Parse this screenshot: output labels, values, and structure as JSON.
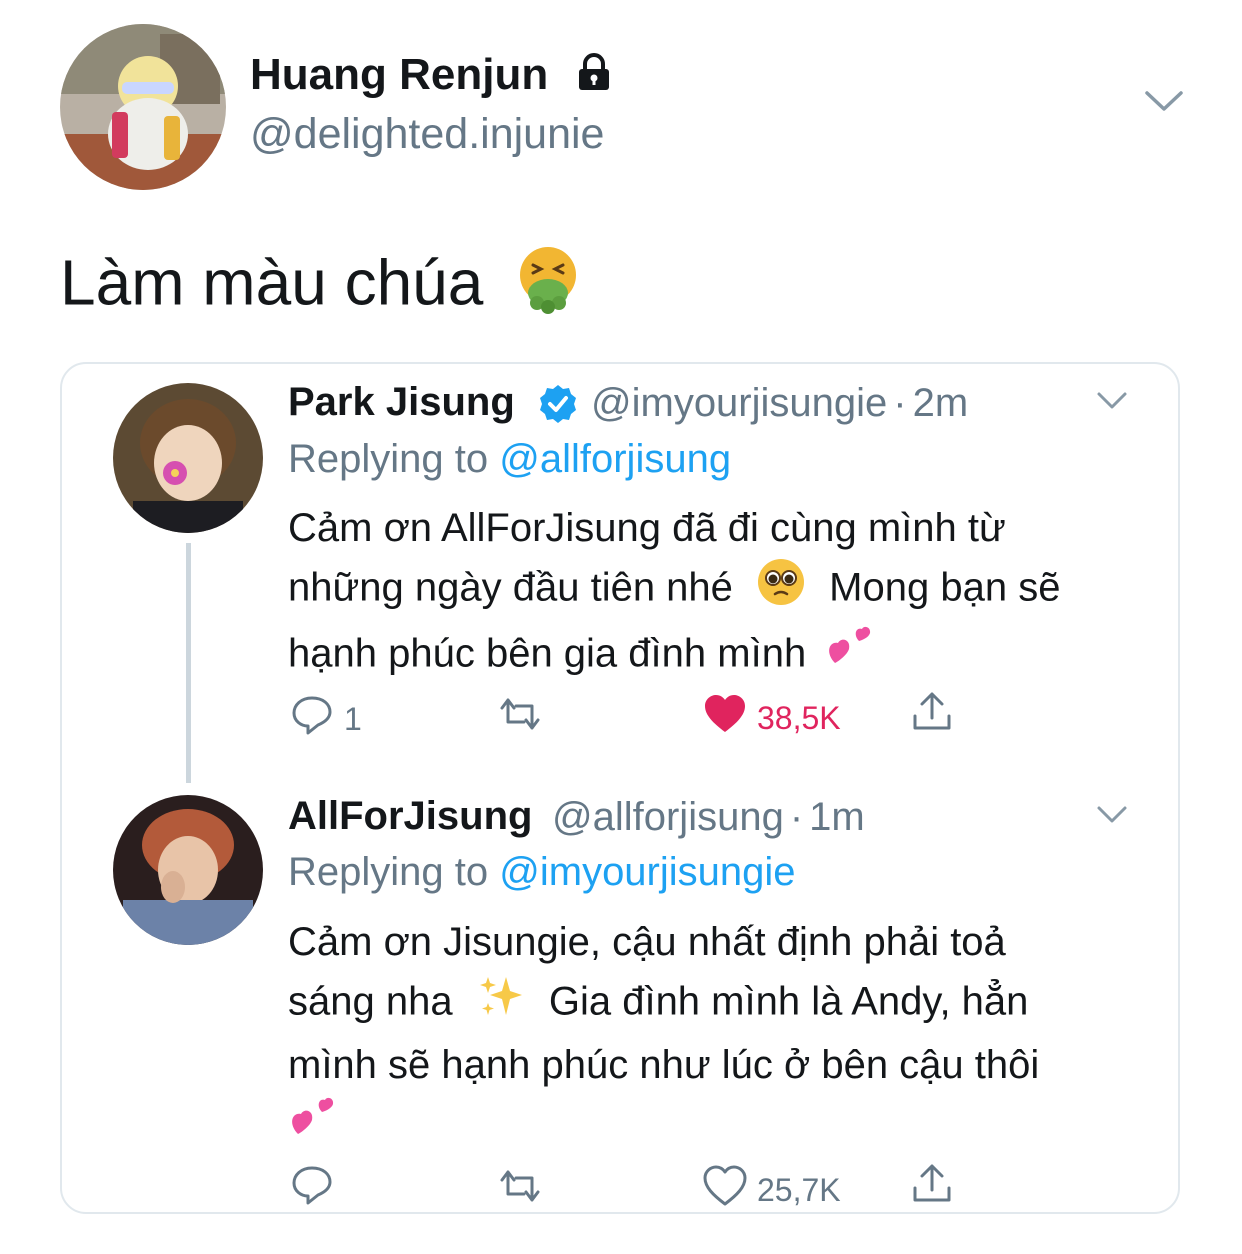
{
  "tweet": {
    "author_name": "Huang Renjun",
    "author_handle": "@delighted.injunie",
    "text": "Làm màu chúa",
    "emoji": "nauseated-face"
  },
  "quote": {
    "first": {
      "name": "Park Jisung",
      "handle": "@imyourjisungie",
      "time_sep": "·",
      "time": "2m",
      "replying_prefix": "Replying to",
      "replying_to": "@allforjisung",
      "line1": "Cảm ơn AllForJisung đã đi cùng mình từ",
      "line2a": "những ngày đầu tiên nhé",
      "line2b": "Mong bạn sẽ",
      "line3": "hạnh phúc bên gia đình mình",
      "reply_count": "1",
      "like_count": "38,5K",
      "liked_color": "#e0245e"
    },
    "second": {
      "name": "AllForJisung",
      "handle": "@allforjisung",
      "time_sep": "·",
      "time": "1m",
      "replying_prefix": "Replying to",
      "replying_to": "@imyourjisungie",
      "line1": "Cảm ơn Jisungie, cậu nhất định phải toả",
      "line2a": "sáng nha",
      "line2b": "Gia đình mình là Andy, hẳn",
      "line3": "mình sẽ hạnh phúc như lúc ở bên cậu thôi",
      "reply_count": "",
      "like_count": "25,7K"
    }
  },
  "colors": {
    "accent": "#1da1f2",
    "secondary_text": "#657786",
    "border": "#e1e8ed"
  }
}
